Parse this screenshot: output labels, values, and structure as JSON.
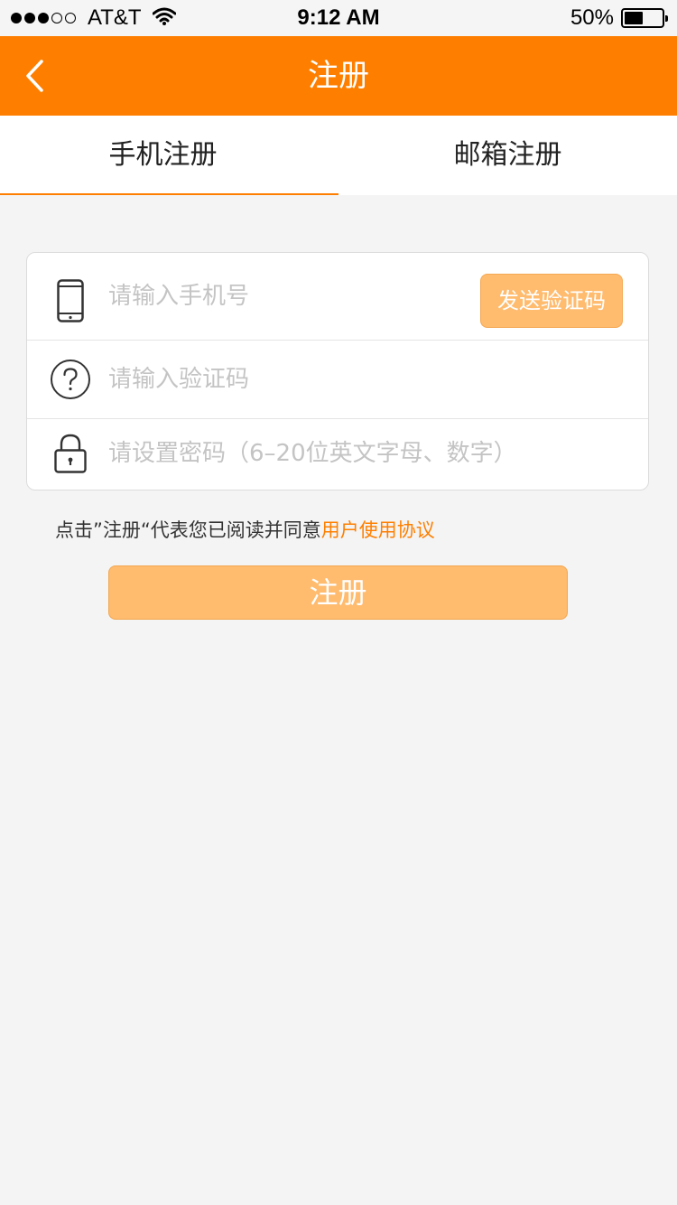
{
  "status_bar": {
    "carrier": "AT&T",
    "time": "9:12 AM",
    "battery_percent": "50%",
    "battery_level": 0.5,
    "signal_bars_filled": 3,
    "signal_bars_total": 5
  },
  "nav": {
    "title": "注册",
    "back_icon": "chevron-left-icon"
  },
  "tabs": [
    {
      "label": "手机注册",
      "active": true
    },
    {
      "label": "邮箱注册",
      "active": false
    }
  ],
  "form": {
    "phone": {
      "placeholder": "请输入手机号",
      "icon": "phone-icon"
    },
    "send_code_label": "发送验证码",
    "code": {
      "placeholder": "请输入验证码",
      "icon": "question-icon"
    },
    "password": {
      "placeholder": "请设置密码（6–20位英文字母、数字）",
      "icon": "lock-icon"
    }
  },
  "agreement": {
    "prefix": "点击”注册“代表您已阅读并同意",
    "link": "用户使用协议"
  },
  "register_label": "注册",
  "colors": {
    "accent": "#fe7f00",
    "button": "#ffbb6e",
    "background": "#f4f4f4"
  }
}
